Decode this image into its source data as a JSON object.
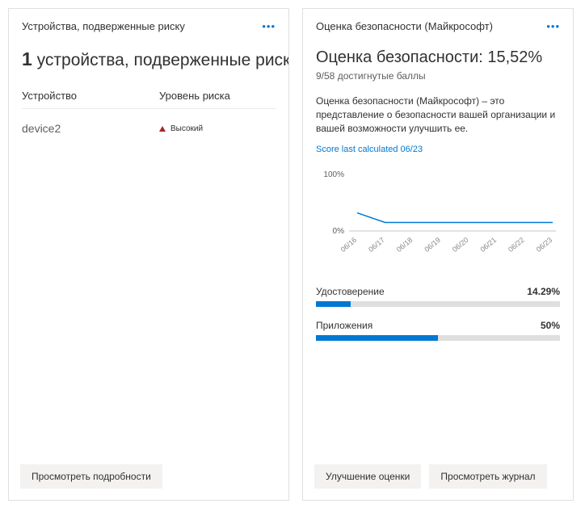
{
  "left": {
    "title": "Устройства, подверженные риску",
    "count": "1",
    "heading_rest": " устройства, подверженные риску",
    "col_device": "Устройство",
    "col_risk": "Уровень риска",
    "rows": [
      {
        "device": "device2",
        "risk_label": "Высокий"
      }
    ],
    "btn_details": "Просмотреть подробности"
  },
  "right": {
    "title": "Оценка безопасности (Майкрософт)",
    "score_heading": "Оценка безопасности: 15,52%",
    "score_sub": "9/58 достигнутые баллы",
    "score_desc": "Оценка безопасности (Майкрософт) – это представление о безопасности вашей организации и вашей возможности улучшить ее.",
    "score_calc": "Score last calculated 06/23",
    "bars": [
      {
        "label": "Удостоверение",
        "value": "14.29%",
        "pct": 14.29
      },
      {
        "label": "Приложения",
        "value": "50%",
        "pct": 50
      }
    ],
    "btn_improve": "Улучшение оценки",
    "btn_history": "Просмотреть журнал"
  },
  "chart_data": {
    "type": "line",
    "title": "",
    "xlabel": "",
    "ylabel": "",
    "ylim": [
      0,
      100
    ],
    "categories": [
      "06/16",
      "06/17",
      "06/18",
      "06/19",
      "06/20",
      "06/21",
      "06/22",
      "06/23"
    ],
    "values": [
      32,
      15,
      15,
      15,
      15,
      15,
      15,
      15
    ],
    "yticks": [
      "0%",
      "100%"
    ]
  }
}
